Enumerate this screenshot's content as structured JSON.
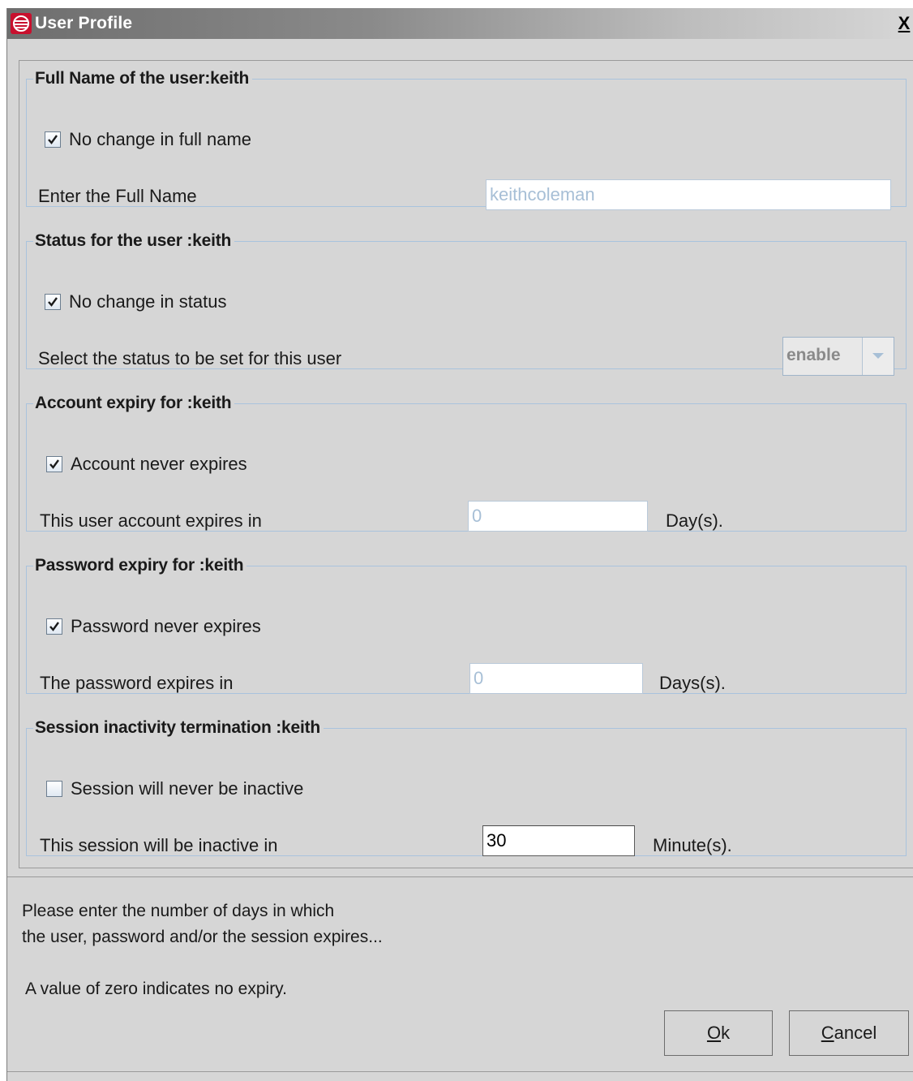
{
  "window": {
    "title": "User Profile",
    "close_label": "X"
  },
  "sections": {
    "full_name": {
      "legend": "Full Name of the user:keith",
      "checkbox_label": "No change in full name",
      "checkbox_checked": true,
      "field_label": "Enter the Full Name",
      "value": "keithcoleman"
    },
    "status": {
      "legend": "Status for the user :keith",
      "checkbox_label": "No change in status",
      "checkbox_checked": true,
      "field_label": "Select the status to be set for this user",
      "selected_value": "enable"
    },
    "account_expiry": {
      "legend": "Account expiry for :keith",
      "checkbox_label": "Account never expires",
      "checkbox_checked": true,
      "field_label": "This user account expires in",
      "value": "0",
      "unit": "Day(s)."
    },
    "password_expiry": {
      "legend": "Password expiry for :keith",
      "checkbox_label": "Password never expires",
      "checkbox_checked": true,
      "field_label": "The password expires in",
      "value": "0",
      "unit": "Days(s)."
    },
    "session": {
      "legend": "Session inactivity termination :keith",
      "checkbox_label": "Session will never be inactive",
      "checkbox_checked": false,
      "field_label": "This session will be inactive in",
      "value": "30",
      "unit": "Minute(s)."
    }
  },
  "info": {
    "line1": "Please enter the number of days in which",
    "line2": "the user, password and/or the session expires...",
    "line3": "A value of zero indicates no expiry."
  },
  "buttons": {
    "ok_mnemonic": "O",
    "ok_rest": "k",
    "cancel_mnemonic": "C",
    "cancel_rest": "ancel"
  },
  "colors": {
    "title_gradient_start": "#6e6e6e",
    "group_border": "#a9c3dd",
    "disabled_text": "#a7bfd6",
    "app_icon": "#c8102e"
  }
}
